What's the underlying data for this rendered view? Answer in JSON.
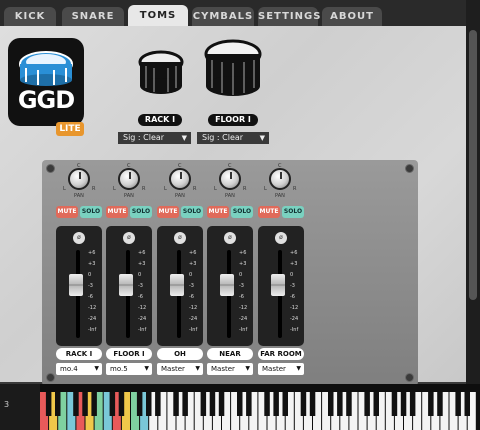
{
  "tabs": [
    {
      "label": "KICK",
      "active": false
    },
    {
      "label": "SNARE",
      "active": false
    },
    {
      "label": "TOMS",
      "active": true
    },
    {
      "label": "CYMBALS",
      "active": false
    },
    {
      "label": "SETTINGS",
      "active": false
    },
    {
      "label": "ABOUT",
      "active": false
    }
  ],
  "logo": {
    "text": "GGD",
    "badge": "LITE",
    "accent": "#2a8fd6"
  },
  "drums": [
    {
      "label": "RACK I",
      "dropdown": "Sig : Clear"
    },
    {
      "label": "FLOOR I",
      "dropdown": "Sig : Clear"
    }
  ],
  "mixer": {
    "mute_label": "MUTE",
    "solo_label": "SOLO",
    "pan_label": "PAN",
    "phase_symbol": "ø",
    "knob_marks": {
      "center": "C",
      "left": "L",
      "right": "R"
    },
    "scale": [
      "+6",
      "+3",
      "0",
      "-3",
      "-6",
      "-12",
      "-24",
      "-Inf"
    ],
    "channels": [
      {
        "name": "RACK I",
        "route": "mo.4",
        "fader_db": "0"
      },
      {
        "name": "FLOOR I",
        "route": "mo.5",
        "fader_db": "0"
      },
      {
        "name": "OH",
        "route": "Master",
        "fader_db": "0"
      },
      {
        "name": "NEAR ROOM",
        "route": "Master",
        "fader_db": "0"
      },
      {
        "name": "FAR ROOM",
        "route": "Master",
        "fader_db": "0"
      }
    ]
  },
  "keyboard": {
    "octave_label": "3",
    "colored_keys": [
      "#e85a5a",
      "#f0c84a",
      "#7fd1a0",
      "#7ac8d8"
    ]
  }
}
